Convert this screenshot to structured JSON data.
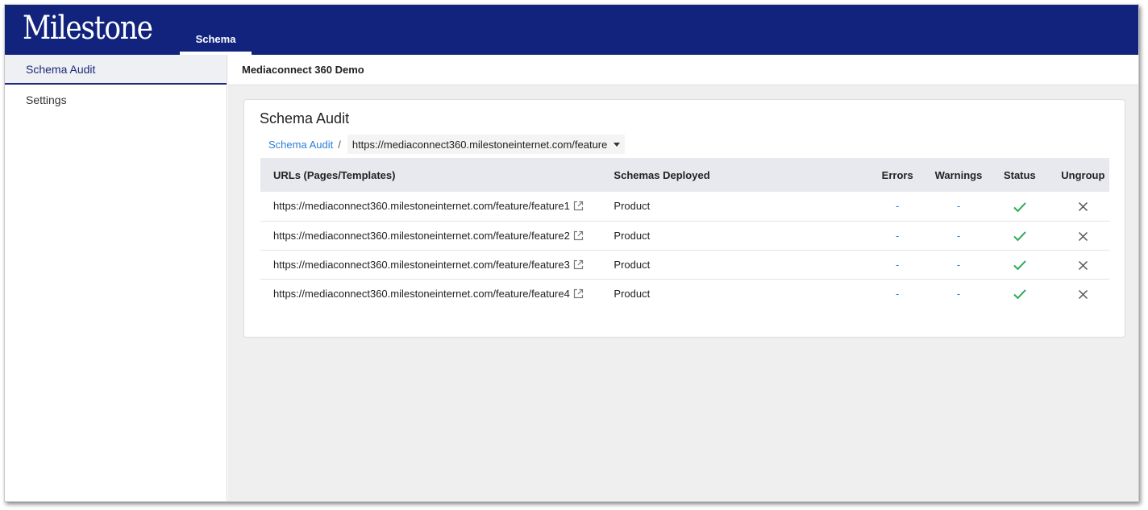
{
  "header": {
    "logo_text": "Milestone",
    "nav_tab": "Schema",
    "brand_color": "#11237d"
  },
  "sidebar": {
    "items": [
      {
        "label": "Schema Audit",
        "active": true
      },
      {
        "label": "Settings",
        "active": false
      }
    ]
  },
  "main": {
    "subheader": "Mediaconnect 360 Demo",
    "card": {
      "title": "Schema Audit",
      "breadcrumb": {
        "link": "Schema Audit",
        "separator": "/",
        "selected_url": "https://mediaconnect360.milestoneinternet.com/feature"
      },
      "table": {
        "headers": {
          "url": "URLs (Pages/Templates)",
          "schemas": "Schemas Deployed",
          "errors": "Errors",
          "warnings": "Warnings",
          "status": "Status",
          "ungroup": "Ungroup"
        },
        "rows": [
          {
            "url": "https://mediaconnect360.milestoneinternet.com/feature/feature1",
            "schema": "Product",
            "errors": "-",
            "warnings": "-",
            "status": "check-icon",
            "ungroup": "close-icon"
          },
          {
            "url": "https://mediaconnect360.milestoneinternet.com/feature/feature2",
            "schema": "Product",
            "errors": "-",
            "warnings": "-",
            "status": "check-icon",
            "ungroup": "close-icon"
          },
          {
            "url": "https://mediaconnect360.milestoneinternet.com/feature/feature3",
            "schema": "Product",
            "errors": "-",
            "warnings": "-",
            "status": "check-icon",
            "ungroup": "close-icon"
          },
          {
            "url": "https://mediaconnect360.milestoneinternet.com/feature/feature4",
            "schema": "Product",
            "errors": "-",
            "warnings": "-",
            "status": "check-icon",
            "ungroup": "close-icon"
          }
        ]
      }
    }
  },
  "colors": {
    "link": "#2b7fd6",
    "status_ok": "#2eaa57"
  }
}
